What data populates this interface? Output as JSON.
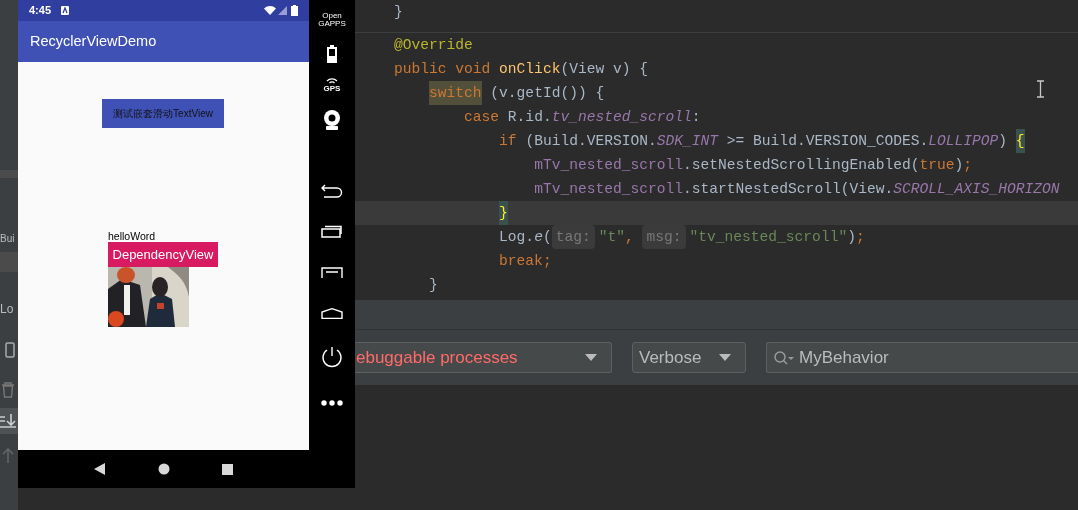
{
  "ide": {
    "side_strip": {
      "labels": [
        "Bui",
        "Lo"
      ]
    },
    "editor": {
      "lines": [
        {
          "current": false,
          "tokens": [
            {
              "kind": "plain",
              "text": "}"
            }
          ]
        },
        {
          "current": false,
          "tokens": [
            {
              "kind": "annotation",
              "text": "@Override"
            }
          ]
        },
        {
          "current": false,
          "tokens": [
            {
              "kind": "keyword",
              "text": "public void "
            },
            {
              "kind": "method",
              "text": "onClick"
            },
            {
              "kind": "plain",
              "text": "(View v) {"
            }
          ]
        },
        {
          "current": false,
          "tokens": [
            {
              "kind": "keyword_highlight",
              "text": "    switch"
            },
            {
              "kind": "plain",
              "text": " (v.getId()) {"
            }
          ]
        },
        {
          "current": false,
          "tokens": [
            {
              "kind": "keyword",
              "text": "        case "
            },
            {
              "kind": "plain",
              "text": "R.id."
            },
            {
              "kind": "static_field",
              "text": "tv_nested_scroll"
            },
            {
              "kind": "plain",
              "text": ":"
            }
          ]
        },
        {
          "current": false,
          "tokens": [
            {
              "kind": "keyword",
              "text": "            if "
            },
            {
              "kind": "plain",
              "text": "(Build.VERSION."
            },
            {
              "kind": "static_field",
              "text": "SDK_INT"
            },
            {
              "kind": "plain",
              "text": " >= Build.VERSION_CODES."
            },
            {
              "kind": "static_field",
              "text": "LOLLIPOP"
            },
            {
              "kind": "plain",
              "text": ") "
            },
            {
              "kind": "brace_match",
              "text": "{"
            }
          ]
        },
        {
          "current": false,
          "tokens": [
            {
              "kind": "field",
              "text": "                mTv_nested_scroll"
            },
            {
              "kind": "plain",
              "text": ".setNestedScrollingEnabled("
            },
            {
              "kind": "keyword",
              "text": "true"
            },
            {
              "kind": "plain",
              "text": ")"
            },
            {
              "kind": "keyword",
              "text": ";"
            }
          ]
        },
        {
          "current": false,
          "tokens": [
            {
              "kind": "field",
              "text": "                mTv_nested_scroll"
            },
            {
              "kind": "plain",
              "text": ".startNestedScroll(View."
            },
            {
              "kind": "static_field",
              "text": "SCROLL_AXIS_HORIZON"
            }
          ]
        },
        {
          "current": true,
          "tokens": [
            {
              "kind": "brace_match",
              "text": "            }"
            }
          ]
        },
        {
          "current": false,
          "tokens": [
            {
              "kind": "plain",
              "text": "            Log."
            },
            {
              "kind": "static_method",
              "text": "e"
            },
            {
              "kind": "plain",
              "text": "("
            },
            {
              "kind": "hint",
              "text": "tag:"
            },
            {
              "kind": "string",
              "text": "\"t\""
            },
            {
              "kind": "keyword",
              "text": ", "
            },
            {
              "kind": "hint",
              "text": "msg:"
            },
            {
              "kind": "string",
              "text": "\"tv_nested_scroll\""
            },
            {
              "kind": "plain",
              "text": ")"
            },
            {
              "kind": "keyword",
              "text": ";"
            }
          ]
        },
        {
          "current": false,
          "tokens": [
            {
              "kind": "keyword",
              "text": "            break;"
            }
          ]
        },
        {
          "current": false,
          "tokens": [
            {
              "kind": "plain",
              "text": "    }"
            }
          ]
        }
      ]
    },
    "logcat": {
      "process_dropdown": "ebuggable processes",
      "level_dropdown": "Verbose",
      "search": {
        "value": "MyBehavior"
      }
    }
  },
  "emulator": {
    "status_bar": {
      "time": "4:45"
    },
    "app_bar": {
      "title": "RecyclerViewDemo"
    },
    "nested_scroll_button": {
      "label": "测试嵌套滑动TextView"
    },
    "hello_text": "helloWord",
    "dependency_view": {
      "label": "DependencyView"
    },
    "side_panel": {
      "gapps_top": "Open",
      "gapps_bottom": "GAPPS",
      "gps_label": "GPS"
    }
  }
}
